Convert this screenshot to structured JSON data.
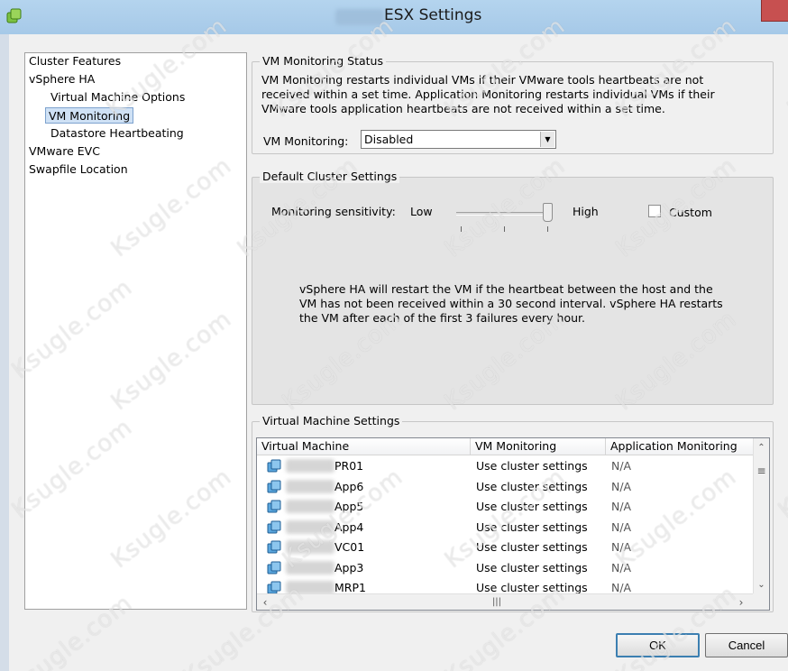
{
  "window": {
    "title": "ESX Settings"
  },
  "nav": {
    "items": [
      {
        "label": "Cluster Features"
      },
      {
        "label": "vSphere HA"
      },
      {
        "label": "Virtual Machine Options"
      },
      {
        "label": "VM Monitoring"
      },
      {
        "label": "Datastore Heartbeating"
      },
      {
        "label": "VMware EVC"
      },
      {
        "label": "Swapfile Location"
      }
    ]
  },
  "vm_monitoring_status": {
    "title": "VM Monitoring Status",
    "description": "VM Monitoring restarts individual VMs if their VMware tools heartbeats are not received within a set time.  Application Monitoring restarts individual VMs if their VMware tools application heartbeats are not received within a set time.",
    "field_label": "VM Monitoring:",
    "selected_value": "Disabled"
  },
  "default_cluster_settings": {
    "title": "Default Cluster Settings",
    "sensitivity_label": "Monitoring sensitivity:",
    "low_label": "Low",
    "high_label": "High",
    "custom_label": "Custom",
    "custom_checked": false,
    "sensitivity_level": "High",
    "description": "vSphere HA will restart the VM if the heartbeat between the host and the VM has not been received within a 30 second interval. vSphere HA restarts the VM after each of the first 3 failures every hour."
  },
  "vm_settings": {
    "title": "Virtual Machine Settings",
    "columns": [
      "Virtual Machine",
      "VM Monitoring",
      "Application Monitoring"
    ],
    "rows": [
      {
        "name": "PR01",
        "vm_monitoring": "Use cluster settings",
        "app_monitoring": "N/A"
      },
      {
        "name": "App6",
        "vm_monitoring": "Use cluster settings",
        "app_monitoring": "N/A"
      },
      {
        "name": "App5",
        "vm_monitoring": "Use cluster settings",
        "app_monitoring": "N/A"
      },
      {
        "name": "App4",
        "vm_monitoring": "Use cluster settings",
        "app_monitoring": "N/A"
      },
      {
        "name": "VC01",
        "vm_monitoring": "Use cluster settings",
        "app_monitoring": "N/A"
      },
      {
        "name": "App3",
        "vm_monitoring": "Use cluster settings",
        "app_monitoring": "N/A"
      },
      {
        "name": "MRP1",
        "vm_monitoring": "Use cluster settings",
        "app_monitoring": "N/A"
      }
    ]
  },
  "buttons": {
    "ok": "OK",
    "cancel": "Cancel"
  },
  "watermark": "Ksugle.com",
  "colors": {
    "titlebar": "#a6c9e8",
    "selection": "#cfe1f5",
    "default_button_border": "#3c7fb1"
  }
}
